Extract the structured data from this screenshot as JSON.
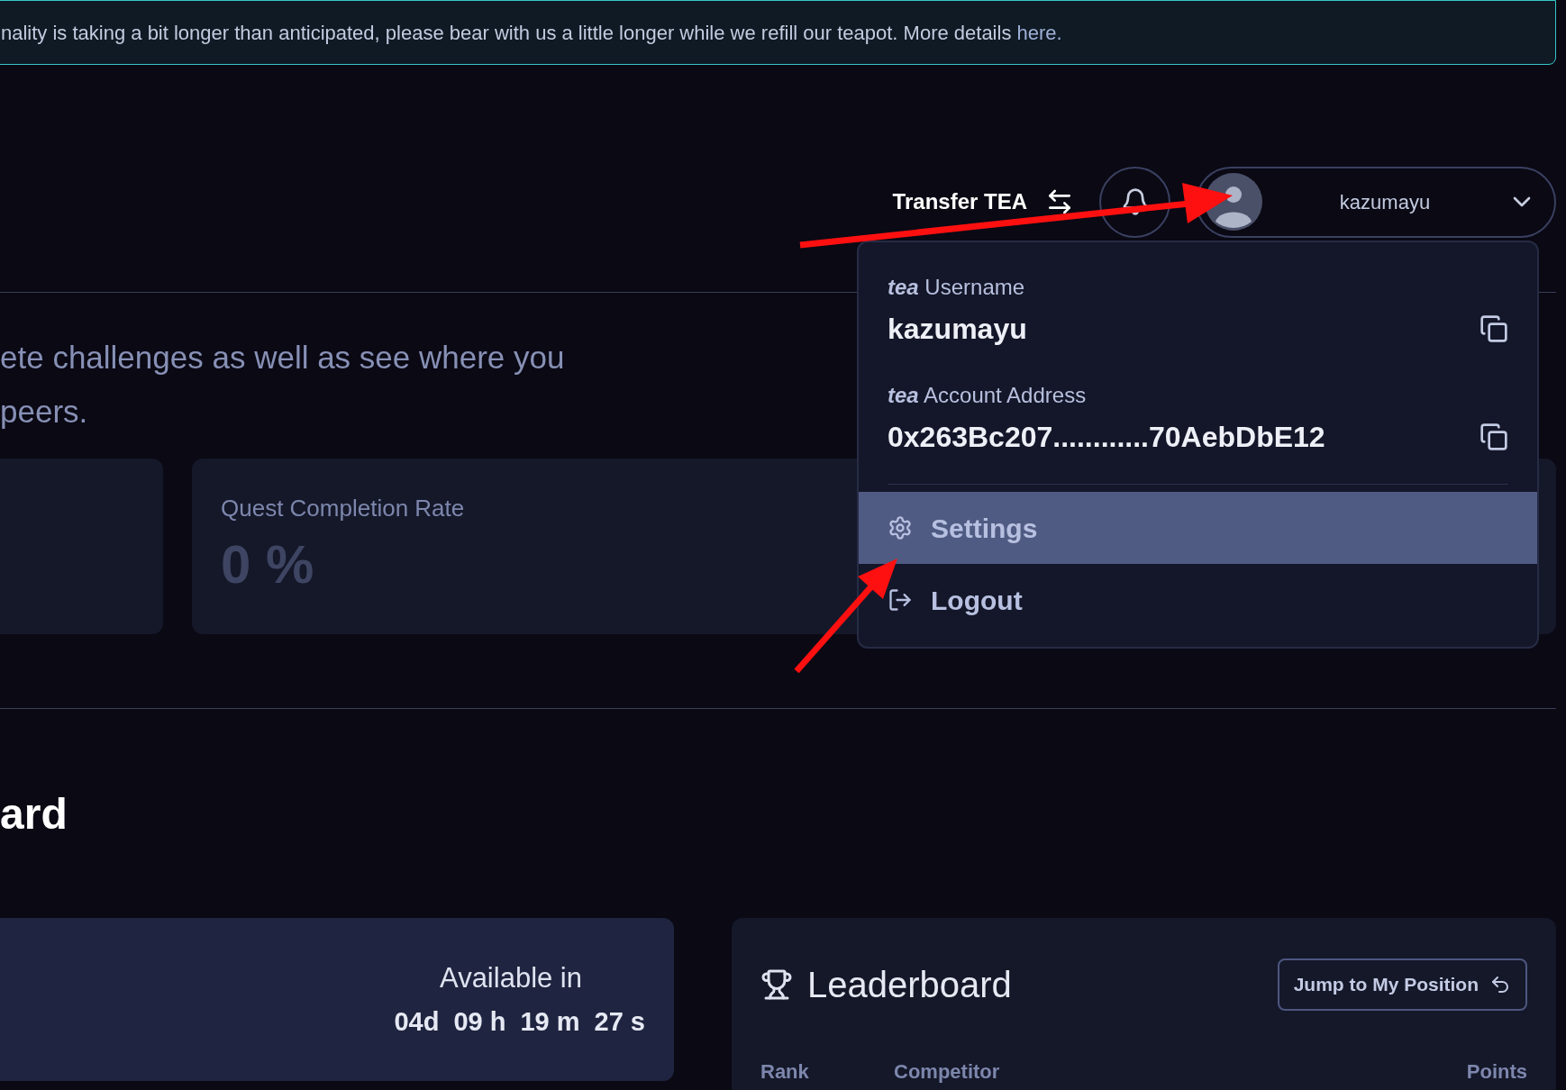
{
  "banner": {
    "text": "nality is taking a bit longer than anticipated, please bear with us a little longer while we refill our teapot. More details ",
    "link": "here."
  },
  "header": {
    "transfer": "Transfer TEA",
    "user": "kazumayu"
  },
  "intro": [
    "ete challenges as well as see where you",
    "peers."
  ],
  "stat_card": {
    "label": "Quest Completion Rate",
    "value": "0 %"
  },
  "section_title": "ard",
  "countdown": {
    "label": "Available in",
    "parts": [
      "04d",
      "09 h",
      "19 m",
      "27 s"
    ]
  },
  "leaderboard": {
    "title": "Leaderboard",
    "jump_button": "Jump to My Position",
    "columns": [
      "Rank",
      "Competitor",
      "Points"
    ]
  },
  "menu": {
    "fields": [
      {
        "prefix": "tea",
        "label": "Username",
        "value": "kazumayu"
      },
      {
        "prefix": "tea",
        "label": "Account Address",
        "value": "0x263Bc207............70AebDbE12"
      }
    ],
    "items": [
      {
        "kind": "settings",
        "label": "Settings",
        "selected": true
      },
      {
        "kind": "logout",
        "label": "Logout",
        "selected": false
      }
    ]
  }
}
